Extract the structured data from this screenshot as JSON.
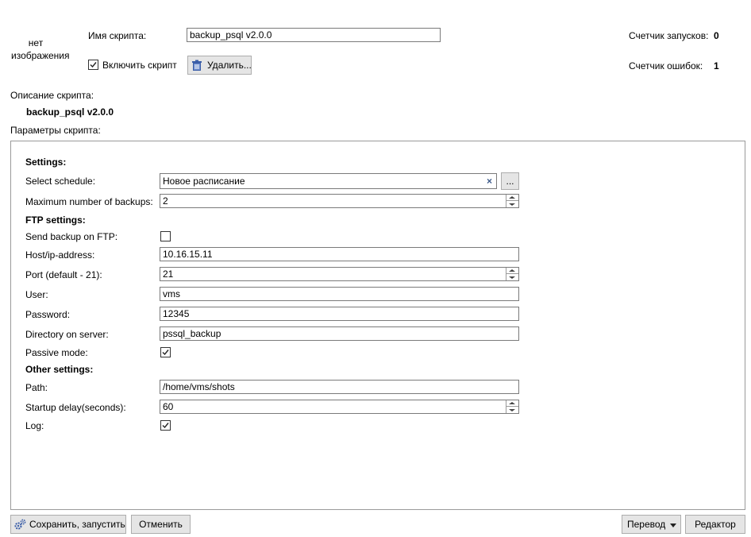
{
  "header": {
    "no_image_text": "нет изображения",
    "script_name_label": "Имя скрипта:",
    "script_name_value": "backup_psql v2.0.0",
    "enable_script_label": "Включить скрипт",
    "enable_script_checked": true,
    "delete_button": "Удалить...",
    "run_counter_label": "Счетчик запусков:",
    "run_counter_value": "0",
    "error_counter_label": "Счетчик ошибок:",
    "error_counter_value": "1"
  },
  "description": {
    "label": "Описание скрипта:",
    "value": "backup_psql v2.0.0"
  },
  "params": {
    "label": "Параметры скрипта:",
    "settings_heading": "Settings:",
    "schedule_label": "Select schedule:",
    "schedule_value": "Новое расписание",
    "schedule_more": "...",
    "max_backups_label": "Maximum number of backups:",
    "max_backups_value": "2",
    "ftp_heading": "FTP settings:",
    "send_ftp_label": "Send backup on FTP:",
    "send_ftp_checked": false,
    "host_label": "Host/ip-address:",
    "host_value": "10.16.15.11",
    "port_label": "Port (default - 21):",
    "port_value": "21",
    "user_label": "User:",
    "user_value": "vms",
    "password_label": "Password:",
    "password_value": "12345",
    "directory_label": "Directory on server:",
    "directory_value": "pssql_backup",
    "passive_label": "Passive mode:",
    "passive_checked": true,
    "other_heading": "Other settings:",
    "path_label": "Path:",
    "path_value": "/home/vms/shots",
    "delay_label": "Startup delay(seconds):",
    "delay_value": "60",
    "log_label": "Log:",
    "log_checked": true
  },
  "footer": {
    "save_run_button": "Сохранить, запустить",
    "cancel_button": "Отменить",
    "translate_button": "Перевод",
    "editor_button": "Редактор"
  }
}
